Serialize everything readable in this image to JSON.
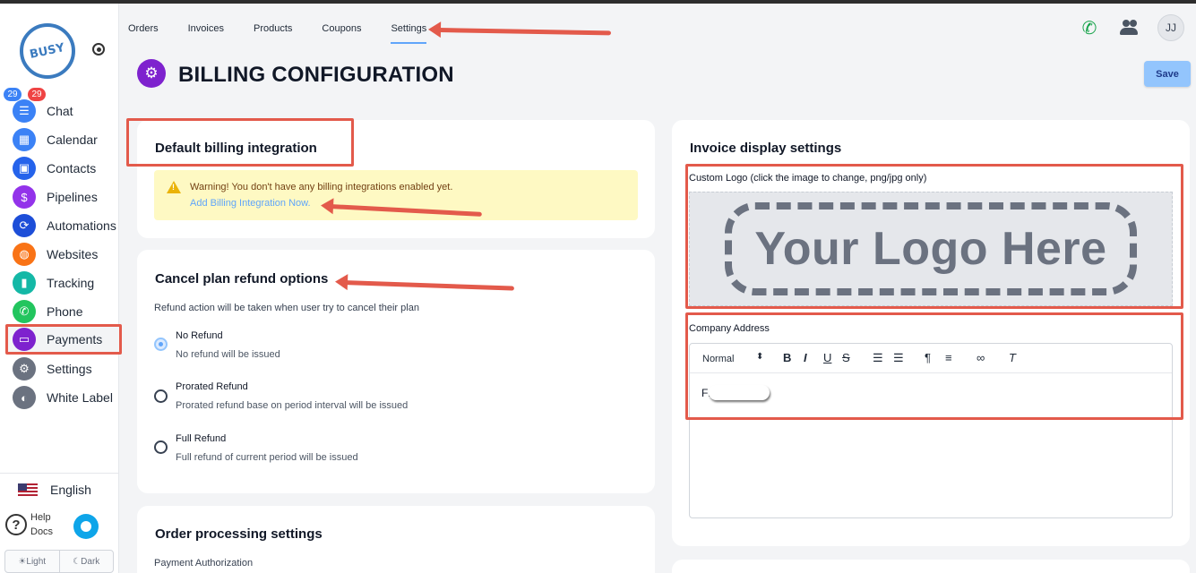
{
  "sidebar": {
    "logo_text": "BUSY",
    "badges": {
      "left": "29",
      "right": "29"
    },
    "items": [
      {
        "label": "Chat",
        "icon": "chat-icon",
        "color": "#3b82f6"
      },
      {
        "label": "Calendar",
        "icon": "calendar-icon",
        "color": "#3b82f6"
      },
      {
        "label": "Contacts",
        "icon": "contacts-icon",
        "color": "#2563eb"
      },
      {
        "label": "Pipelines",
        "icon": "pipelines-icon",
        "color": "#9333ea"
      },
      {
        "label": "Automations",
        "icon": "automations-icon",
        "color": "#1d4ed8"
      },
      {
        "label": "Websites",
        "icon": "websites-icon",
        "color": "#f97316"
      },
      {
        "label": "Tracking",
        "icon": "tracking-icon",
        "color": "#14b8a6"
      },
      {
        "label": "Phone",
        "icon": "phone-icon",
        "color": "#22c55e"
      },
      {
        "label": "Payments",
        "icon": "payments-icon",
        "color": "#7e22ce"
      },
      {
        "label": "Settings",
        "icon": "settings-icon",
        "color": "#6b7280"
      },
      {
        "label": "White Label",
        "icon": "white-label-icon",
        "color": "#6b7280"
      }
    ],
    "language": "English",
    "help_label": "Help Docs",
    "theme": {
      "light": "Light",
      "dark": "Dark"
    }
  },
  "topnav": {
    "tabs": [
      "Orders",
      "Invoices",
      "Products",
      "Coupons",
      "Settings"
    ],
    "active_tab": "Settings",
    "avatar_initials": "JJ"
  },
  "page": {
    "title": "BILLING CONFIGURATION",
    "save_label": "Save"
  },
  "billing_integration": {
    "heading": "Default billing integration",
    "warning": "Warning! You don't have any billing integrations enabled yet.",
    "link": "Add Billing Integration Now."
  },
  "refund": {
    "heading": "Cancel plan refund options",
    "description": "Refund action will be taken when user try to cancel their plan",
    "options": [
      {
        "title": "No Refund",
        "desc": "No refund will be issued",
        "checked": true
      },
      {
        "title": "Prorated Refund",
        "desc": "Prorated refund base on period interval will be issued",
        "checked": false
      },
      {
        "title": "Full Refund",
        "desc": "Full refund of current period will be issued",
        "checked": false
      }
    ]
  },
  "order_processing": {
    "heading": "Order processing settings",
    "sub_label": "Payment Authorization"
  },
  "invoice_display": {
    "heading": "Invoice display settings",
    "logo_label": "Custom Logo (click the image to change, png/jpg only)",
    "logo_placeholder": "Your Logo Here",
    "address_label": "Company Address",
    "editor_format": "Normal",
    "editor_text": "F:"
  },
  "colors": {
    "accent": "#60a5fa",
    "annotation": "#e35a4b",
    "brand_purple": "#7e22ce"
  }
}
